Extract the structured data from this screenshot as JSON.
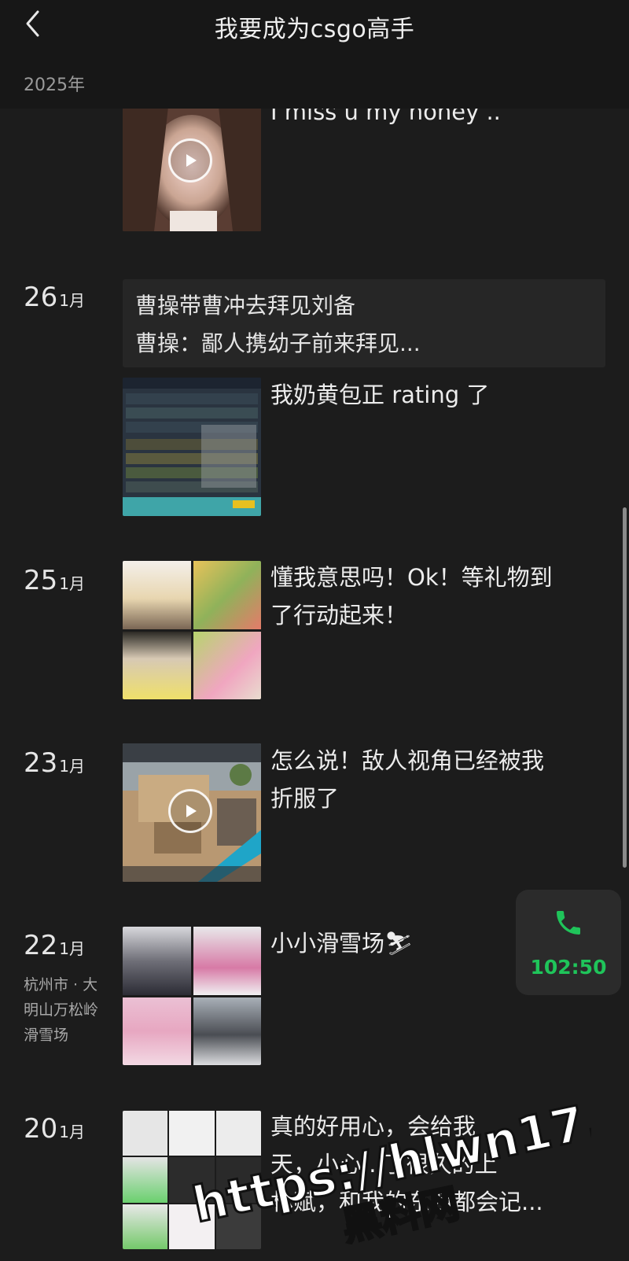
{
  "header": {
    "title": "我要成为csgo高手",
    "year": "2025年"
  },
  "posts": [
    {
      "text": "I miss u my honey .."
    },
    {
      "day": "26",
      "month": "1月",
      "quote_line1": "曹操带曹冲去拜见刘备",
      "quote_line2": "曹操：鄙人携幼子前来拜见...",
      "text": "我奶黄包正 rating 了"
    },
    {
      "day": "25",
      "month": "1月",
      "text_line1": "懂我意思吗！Ok！等礼物到",
      "text_line2": "了行动起来！"
    },
    {
      "day": "23",
      "month": "1月",
      "text_line1": "怎么说！敌人视角已经被我",
      "text_line2": "折服了"
    },
    {
      "day": "22",
      "month": "1月",
      "location_line1": "杭州市 · 大",
      "location_line2": "明山万松岭",
      "location_line3": "滑雪场",
      "text": "小小滑雪场⛷"
    },
    {
      "day": "20",
      "month": "1月",
      "text_line1": "真的好用心，会给我",
      "text_line2": "天，小心...了很久的上",
      "text_line3": "林赋，和我的东西都会记..."
    }
  ],
  "call": {
    "time": "102:50",
    "accent": "#1fc45a"
  },
  "watermark": {
    "url": "https://hlwn17.com",
    "name": "黑料网"
  },
  "icons": {
    "back": "chevron-left-icon",
    "play": "play-icon",
    "phone": "phone-icon"
  }
}
